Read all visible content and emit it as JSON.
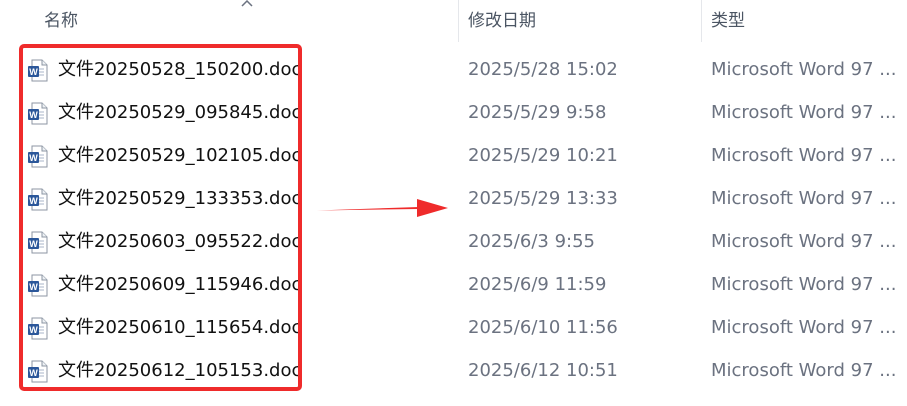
{
  "header": {
    "name_label": "名称",
    "date_label": "修改日期",
    "type_label": "类型"
  },
  "files": [
    {
      "name": "文件20250528_150200.doc",
      "modified": "2025/5/28 15:02",
      "type": "Microsoft Word 97 ..."
    },
    {
      "name": "文件20250529_095845.doc",
      "modified": "2025/5/29 9:58",
      "type": "Microsoft Word 97 ..."
    },
    {
      "name": "文件20250529_102105.doc",
      "modified": "2025/5/29 10:21",
      "type": "Microsoft Word 97 ..."
    },
    {
      "name": "文件20250529_133353.doc",
      "modified": "2025/5/29 13:33",
      "type": "Microsoft Word 97 ..."
    },
    {
      "name": "文件20250603_095522.doc",
      "modified": "2025/6/3 9:55",
      "type": "Microsoft Word 97 ..."
    },
    {
      "name": "文件20250609_115946.doc",
      "modified": "2025/6/9 11:59",
      "type": "Microsoft Word 97 ..."
    },
    {
      "name": "文件20250610_115654.doc",
      "modified": "2025/6/10 11:56",
      "type": "Microsoft Word 97 ..."
    },
    {
      "name": "文件20250612_105153.doc",
      "modified": "2025/6/12 10:51",
      "type": "Microsoft Word 97 ..."
    }
  ],
  "icons": {
    "file_icon": "word-document-icon",
    "sort_icon": "sort-ascending-icon"
  },
  "colors": {
    "highlight": "#ef2b2b",
    "word_blue": "#2b579a"
  }
}
